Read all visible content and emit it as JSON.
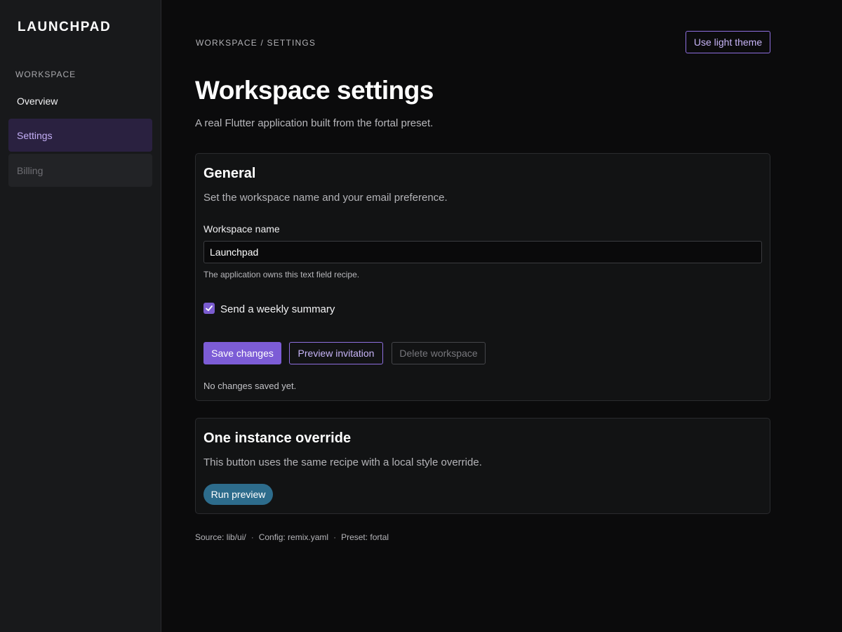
{
  "app": {
    "brand": "LAUNCHPAD"
  },
  "sidebar": {
    "section_label": "WORKSPACE",
    "items": [
      {
        "label": "Overview",
        "state": "default"
      },
      {
        "label": "Settings",
        "state": "active"
      },
      {
        "label": "Billing",
        "state": "disabled"
      }
    ]
  },
  "header": {
    "breadcrumb": "WORKSPACE / SETTINGS",
    "theme_button": "Use light theme",
    "title": "Workspace settings",
    "subtitle": "A real Flutter application built from the fortal preset."
  },
  "general_card": {
    "title": "General",
    "description": "Set the workspace name and your email preference.",
    "name_label": "Workspace name",
    "name_value": "Launchpad",
    "name_help": "The application owns this text field recipe.",
    "checkbox_label": "Send a weekly summary",
    "checkbox_checked": true,
    "save_label": "Save changes",
    "preview_label": "Preview invitation",
    "delete_label": "Delete workspace",
    "status": "No changes saved yet."
  },
  "override_card": {
    "title": "One instance override",
    "description": "This button uses the same recipe with a local style override.",
    "run_label": "Run preview"
  },
  "footer": {
    "source": "Source: lib/ui/",
    "config": "Config: remix.yaml",
    "preset": "Preset: fortal",
    "separator": "·"
  },
  "colors": {
    "background": "#0b0b0c",
    "sidebar": "#18191b",
    "accent": "#7c5cd6",
    "accent_text": "#c7b4f7",
    "override_button": "#2d6c8c"
  },
  "icons": {
    "checkbox": "check-icon"
  }
}
